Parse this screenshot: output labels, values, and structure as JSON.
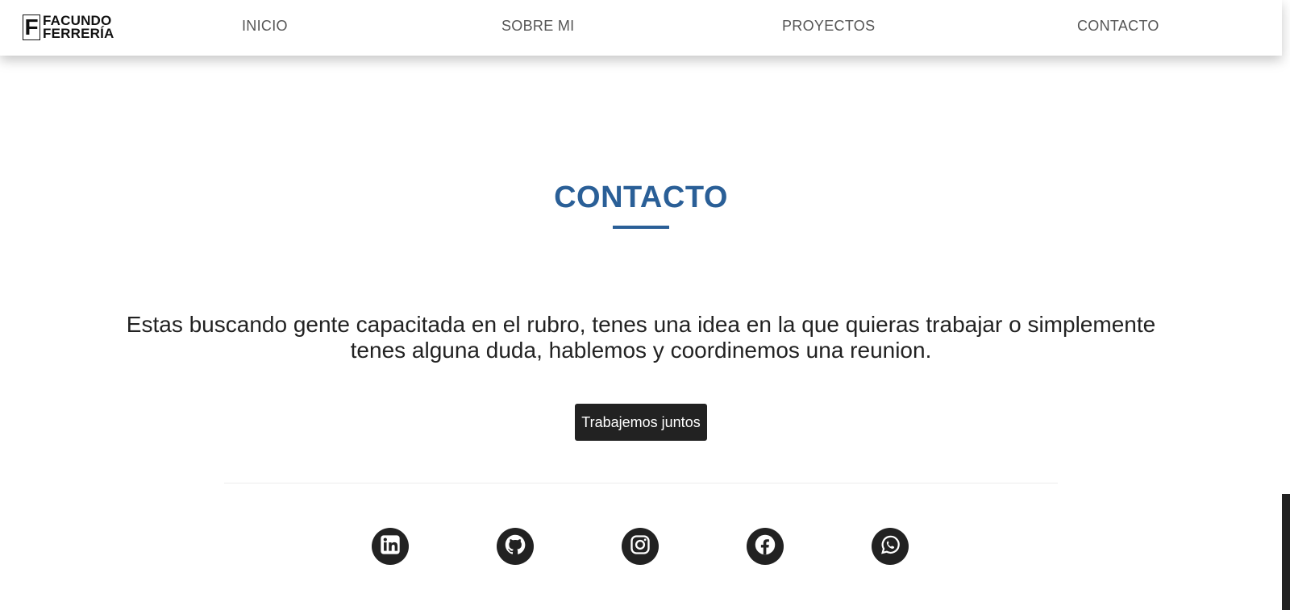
{
  "brand": {
    "mark": "F",
    "line1": "FACUNDO",
    "line2": "FERRERÍA"
  },
  "nav": {
    "items": [
      {
        "label": "INICIO"
      },
      {
        "label": "SOBRE MI"
      },
      {
        "label": "PROYECTOS"
      },
      {
        "label": "CONTACTO"
      }
    ]
  },
  "contact": {
    "title": "CONTACTO",
    "text": "Estas buscando gente capacitada en el rubro, tenes una idea en la que quieras trabajar o simplemente tenes alguna duda, hablemos y coordinemos una reunion.",
    "button_label": "Trabajemos juntos"
  },
  "social": {
    "icons": [
      "linkedin-icon",
      "github-icon",
      "instagram-icon",
      "facebook-icon",
      "whatsapp-icon"
    ]
  },
  "colors": {
    "accent": "#2a5f97",
    "dark": "#222222",
    "nav_text": "#555555",
    "background": "#ffffff"
  }
}
